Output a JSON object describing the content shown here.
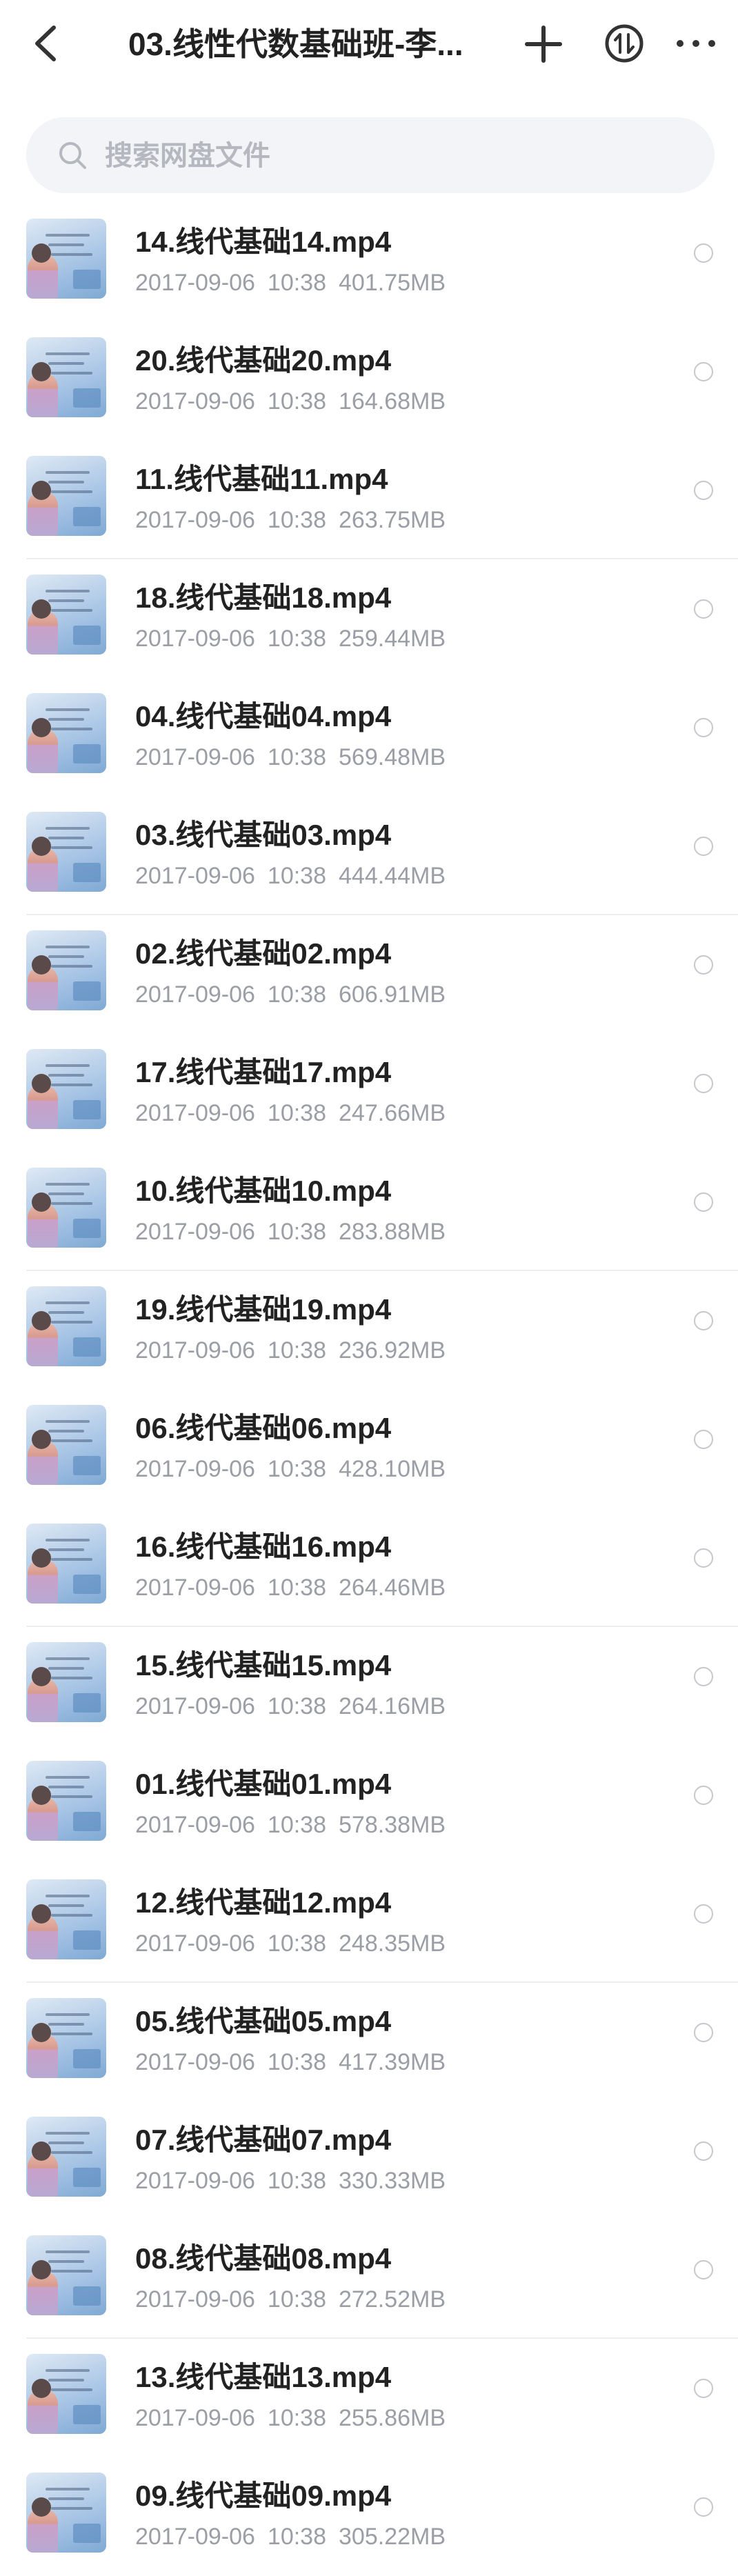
{
  "header": {
    "title": "03.线性代数基础班-李...",
    "icons": {
      "back": "back-chevron-icon",
      "add": "plus-icon",
      "sort": "sort-transfer-icon",
      "more": "more-dots-icon"
    }
  },
  "search": {
    "placeholder": "搜索网盘文件",
    "value": ""
  },
  "files": [
    {
      "name": "14.线代基础14.mp4",
      "date": "2017-09-06",
      "time": "10:38",
      "size": "401.75MB"
    },
    {
      "name": "20.线代基础20.mp4",
      "date": "2017-09-06",
      "time": "10:38",
      "size": "164.68MB"
    },
    {
      "name": "11.线代基础11.mp4",
      "date": "2017-09-06",
      "time": "10:38",
      "size": "263.75MB"
    },
    {
      "name": "18.线代基础18.mp4",
      "date": "2017-09-06",
      "time": "10:38",
      "size": "259.44MB"
    },
    {
      "name": "04.线代基础04.mp4",
      "date": "2017-09-06",
      "time": "10:38",
      "size": "569.48MB"
    },
    {
      "name": "03.线代基础03.mp4",
      "date": "2017-09-06",
      "time": "10:38",
      "size": "444.44MB"
    },
    {
      "name": "02.线代基础02.mp4",
      "date": "2017-09-06",
      "time": "10:38",
      "size": "606.91MB"
    },
    {
      "name": "17.线代基础17.mp4",
      "date": "2017-09-06",
      "time": "10:38",
      "size": "247.66MB"
    },
    {
      "name": "10.线代基础10.mp4",
      "date": "2017-09-06",
      "time": "10:38",
      "size": "283.88MB"
    },
    {
      "name": "19.线代基础19.mp4",
      "date": "2017-09-06",
      "time": "10:38",
      "size": "236.92MB"
    },
    {
      "name": "06.线代基础06.mp4",
      "date": "2017-09-06",
      "time": "10:38",
      "size": "428.10MB"
    },
    {
      "name": "16.线代基础16.mp4",
      "date": "2017-09-06",
      "time": "10:38",
      "size": "264.46MB"
    },
    {
      "name": "15.线代基础15.mp4",
      "date": "2017-09-06",
      "time": "10:38",
      "size": "264.16MB"
    },
    {
      "name": "01.线代基础01.mp4",
      "date": "2017-09-06",
      "time": "10:38",
      "size": "578.38MB"
    },
    {
      "name": "12.线代基础12.mp4",
      "date": "2017-09-06",
      "time": "10:38",
      "size": "248.35MB"
    },
    {
      "name": "05.线代基础05.mp4",
      "date": "2017-09-06",
      "time": "10:38",
      "size": "417.39MB"
    },
    {
      "name": "07.线代基础07.mp4",
      "date": "2017-09-06",
      "time": "10:38",
      "size": "330.33MB"
    },
    {
      "name": "08.线代基础08.mp4",
      "date": "2017-09-06",
      "time": "10:38",
      "size": "272.52MB"
    },
    {
      "name": "13.线代基础13.mp4",
      "date": "2017-09-06",
      "time": "10:38",
      "size": "255.86MB"
    },
    {
      "name": "09.线代基础09.mp4",
      "date": "2017-09-06",
      "time": "10:38",
      "size": "305.22MB"
    }
  ],
  "colors": {
    "title": "#222222",
    "meta": "#9b9ea5",
    "search_bg": "#f3f4f7"
  }
}
